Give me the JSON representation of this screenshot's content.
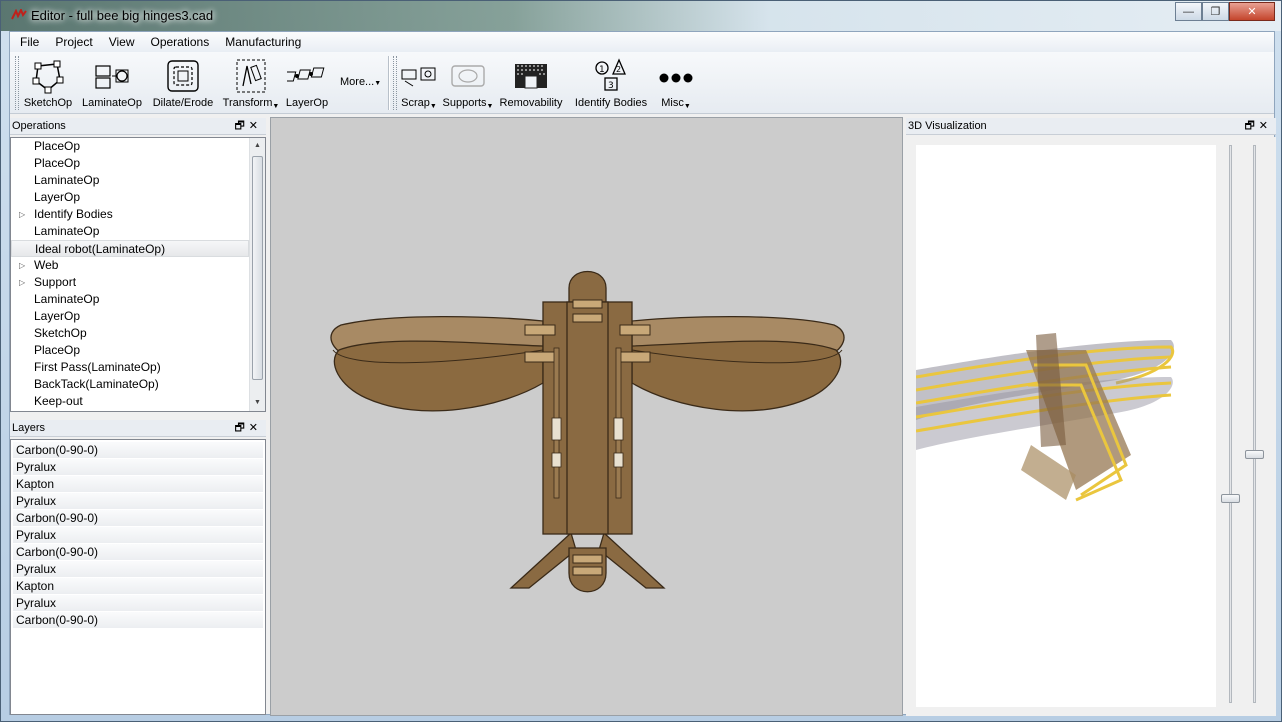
{
  "window": {
    "title": "Editor - full bee big hinges3.cad",
    "controls": {
      "minimize": "—",
      "maximize": "❐",
      "close": "✕"
    }
  },
  "menu": [
    "File",
    "Project",
    "View",
    "Operations",
    "Manufacturing"
  ],
  "toolbar": {
    "group1": [
      {
        "label": "SketchOp",
        "icon": "sketch-op-icon"
      },
      {
        "label": "LaminateOp",
        "icon": "laminate-op-icon"
      },
      {
        "label": "Dilate/Erode",
        "icon": "dilate-erode-icon"
      },
      {
        "label": "Transform",
        "icon": "transform-icon",
        "dropdown": true
      },
      {
        "label": "LayerOp",
        "icon": "layer-op-icon"
      }
    ],
    "more_label": "More...",
    "group2": [
      {
        "label": "Scrap",
        "icon": "scrap-icon",
        "dropdown": true
      },
      {
        "label": "Supports",
        "icon": "supports-icon",
        "dropdown": true
      },
      {
        "label": "Removability",
        "icon": "removability-icon"
      },
      {
        "label": "Identify Bodies",
        "icon": "identify-bodies-icon"
      },
      {
        "label": "Misc",
        "icon": "misc-icon",
        "dropdown": true
      }
    ]
  },
  "operations_panel": {
    "title": "Operations",
    "items": [
      {
        "label": "PlaceOp",
        "expandable": false
      },
      {
        "label": "PlaceOp",
        "expandable": false
      },
      {
        "label": "LaminateOp",
        "expandable": false
      },
      {
        "label": "LayerOp",
        "expandable": false
      },
      {
        "label": "Identify Bodies",
        "expandable": true
      },
      {
        "label": "LaminateOp",
        "expandable": false
      },
      {
        "label": "Ideal robot(LaminateOp)",
        "expandable": false,
        "selected": true
      },
      {
        "label": "Web",
        "expandable": true
      },
      {
        "label": "Support",
        "expandable": true
      },
      {
        "label": "LaminateOp",
        "expandable": false
      },
      {
        "label": "LayerOp",
        "expandable": false
      },
      {
        "label": "SketchOp",
        "expandable": false
      },
      {
        "label": "PlaceOp",
        "expandable": false
      },
      {
        "label": "First Pass(LaminateOp)",
        "expandable": false
      },
      {
        "label": "BackTack(LaminateOp)",
        "expandable": false
      },
      {
        "label": "Keep-out",
        "expandable": false
      }
    ]
  },
  "layers_panel": {
    "title": "Layers",
    "items": [
      "Carbon(0-90-0)",
      "Pyralux",
      "Kapton",
      "Pyralux",
      "Carbon(0-90-0)",
      "Pyralux",
      "Carbon(0-90-0)",
      "Pyralux",
      "Kapton",
      "Pyralux",
      "Carbon(0-90-0)"
    ]
  },
  "viz_panel": {
    "title": "3D Visualization",
    "slider1_level": 0.5,
    "slider2_level": 0.6
  },
  "colors": {
    "wing_dark": "#8b6a40",
    "wing_light": "#a88a64",
    "body": "#8a6a42",
    "outline": "#3a2a18",
    "canvas_bg": "#cccccc",
    "layer_yellow": "#e8c02a",
    "layer_gray": "#8c8a98"
  }
}
